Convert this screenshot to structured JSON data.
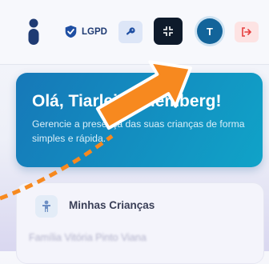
{
  "header": {
    "lgpd_label": "LGPD",
    "avatar_initial": "T",
    "icons": [
      "info-icon",
      "shield-check-icon",
      "key-icon",
      "shrink-icon",
      "logout-icon"
    ],
    "colors": {
      "brand": "#1f3b73",
      "logout": "#e53e3e",
      "dark_button": "#0e1a2b",
      "avatar": "#13649a"
    }
  },
  "welcome": {
    "title": "Olá, Tiarlei Nodemberg!",
    "subtitle": "Gerencie a presença das suas crianças de forma simples e rápida."
  },
  "children": {
    "title": "Minhas Crianças",
    "family_name": "Família Vitória Pinto Viana"
  }
}
